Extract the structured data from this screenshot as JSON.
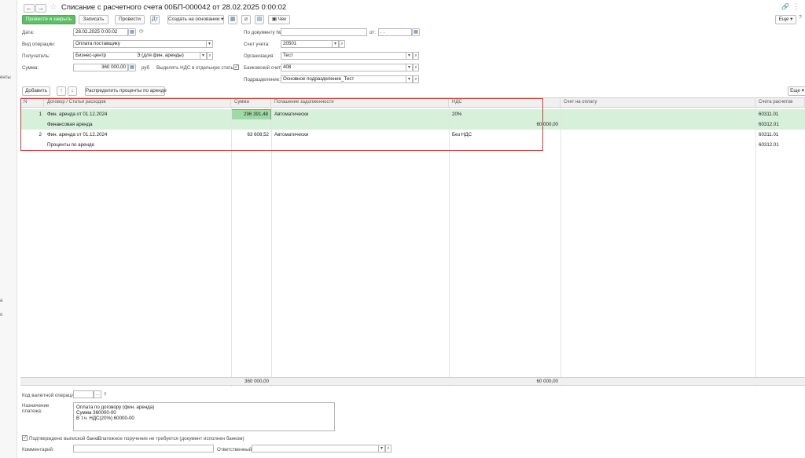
{
  "sidebar": {
    "fragments": [
      "енты",
      "а",
      "о"
    ]
  },
  "header": {
    "back": "←",
    "forward": "→",
    "title": "Списание с расчетного счета 00БП-000042 от 28.02.2025 0:00:02",
    "right_icons": [
      "link-icon",
      "more-vertical-icon",
      "close-icon"
    ]
  },
  "toolbar": {
    "post_close": "Провести и закрыть",
    "save": "Записать",
    "post": "Провести",
    "create_based": "Создать на основании",
    "check": "Чек",
    "more": "Еще"
  },
  "form": {
    "date_label": "Дата:",
    "date_value": "28.02.2025  0:00:02",
    "doc_num_label": "По документу №:",
    "doc_num_value": "",
    "from_label": "от:",
    "from_value": ". .",
    "op_type_label": "Вид операции:",
    "op_type_value": "Оплата поставщику",
    "account_label": "Счет учета:",
    "account_value": "20501",
    "recipient_label": "Получатель:",
    "recipient_value": "Бизнес-центр",
    "recipient_note": "Э (для фин. аренды)",
    "org_label": "Организация:",
    "org_value": "Тест",
    "sum_label": "Сумма:",
    "sum_value": "360 000,00",
    "currency": "руб",
    "vat_split_label": "Выделять НДС в отдельную статью",
    "vat_split_checked": true,
    "bank_account_label": "Банковский счет:",
    "bank_account_value": "408",
    "division_label": "Подразделение:",
    "division_value": "Основное подразделение_Тест"
  },
  "table_toolbar": {
    "add": "Добавить",
    "up": "↑",
    "down": "↓",
    "distribute": "Распределить проценты по аренде",
    "more": "Еще"
  },
  "table": {
    "headers": [
      "N",
      "Договор / Статья расходов",
      "Сумма",
      "Погашение задолженности",
      "НДС",
      "Счет на оплату",
      "Счета расчетов"
    ],
    "rows": [
      {
        "n": "1",
        "contract": "Фин. аренда от 01.12.2024",
        "sum": "296 391,48",
        "repayment": "Автоматически",
        "vat": "20%",
        "invoice": "",
        "acc": "60311.01",
        "article": "Финансовая аренда",
        "vat_sum": "60 000,00",
        "acc2": "60312.01",
        "selected": true
      },
      {
        "n": "2",
        "contract": "Фин. аренда от 01.12.2024",
        "sum": "63 608,52",
        "repayment": "Автоматически",
        "vat": "Без НДС",
        "invoice": "",
        "acc": "60311.01",
        "article": "Проценты по аренде",
        "vat_sum": "",
        "acc2": "60312.01",
        "selected": false
      }
    ],
    "totals": {
      "sum": "360 000,00",
      "vat": "60 000,00"
    }
  },
  "bottom": {
    "currency_op_label": "Код валютной операции:",
    "currency_op_value": "",
    "question": "?",
    "purpose_label": "Назначение\nплатежа:",
    "purpose_lines": [
      "Оплата по договору (фин. аренда)",
      "Сумма 360000-00",
      "В т.ч. НДС(20%) 60000-00"
    ],
    "confirmed_label": "Подтверждено выпиской банка:",
    "confirmed_checked": true,
    "confirmed_note": "Платежное поручение не требуется (документ исполнен банком)",
    "comment_label": "Комментарий:",
    "comment_value": "",
    "responsible_label": "Ответственный:",
    "responsible_value": ""
  }
}
